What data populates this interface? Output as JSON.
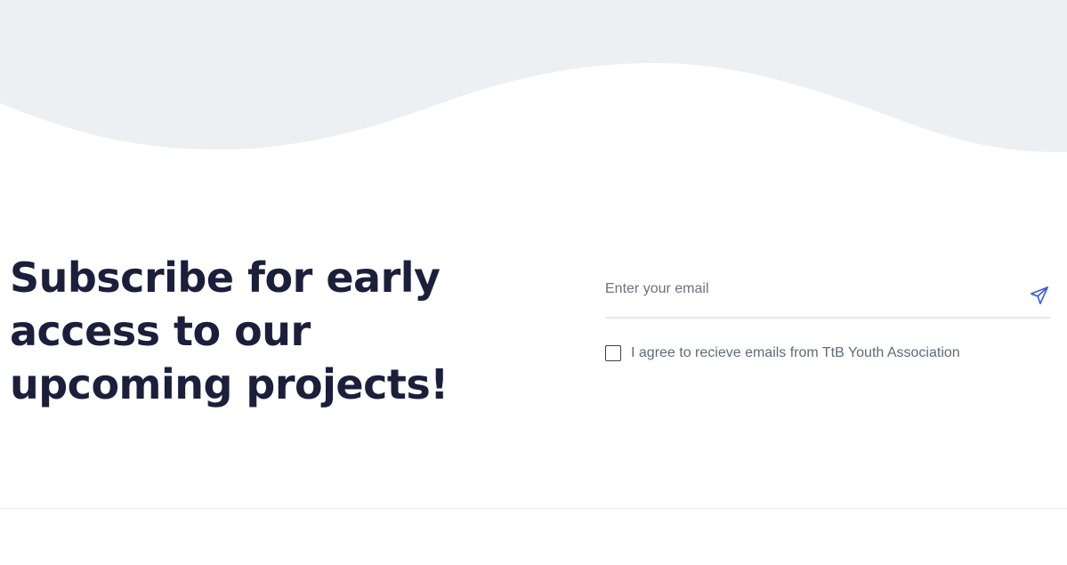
{
  "colors": {
    "wave_background": "#edf0f3",
    "headline_text": "#1b1f3b",
    "send_icon": "#3b5bdb",
    "input_underline": "#e6e8ec",
    "divider": "#e5e7eb"
  },
  "subscribe": {
    "headline": "Subscribe for early access to our upcoming projects!",
    "email_placeholder": "Enter your email",
    "email_value": "",
    "send_icon": "paper-plane-icon",
    "agree_label": "I agree to recieve emails from TtB Youth Association",
    "agree_checked": false
  }
}
